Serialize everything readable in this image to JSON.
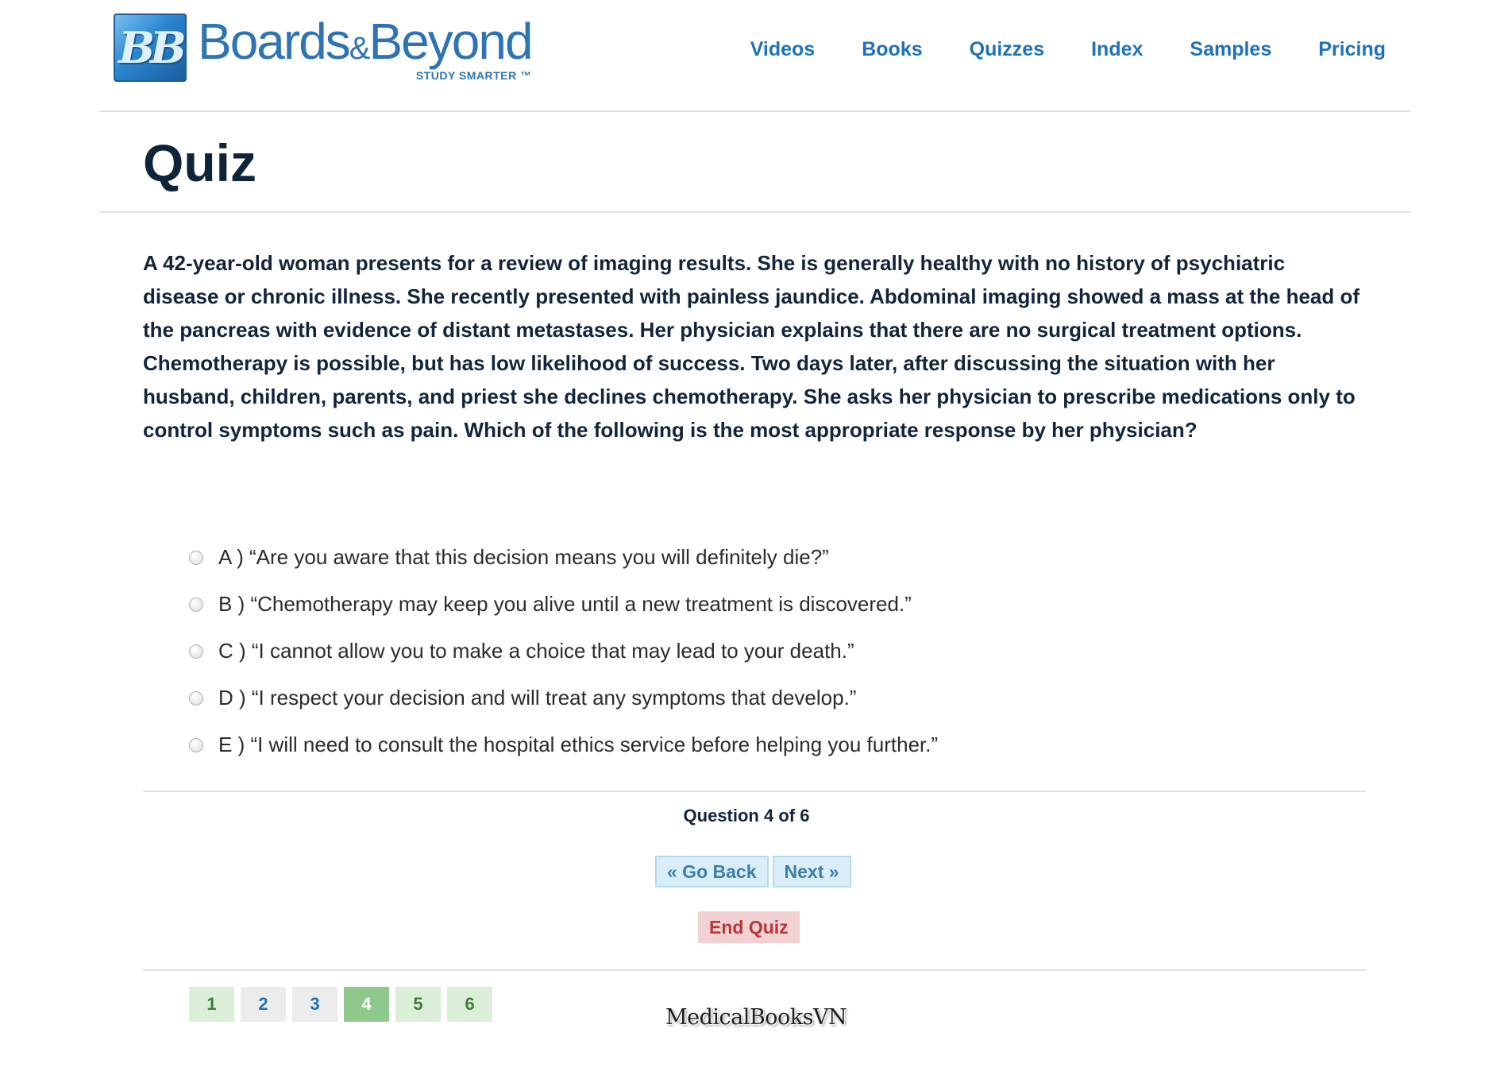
{
  "logo": {
    "mark": "BB",
    "wordmark_left": "Boards",
    "wordmark_amp": "&",
    "wordmark_right": "Beyond",
    "tagline": "STUDY SMARTER ™",
    "brand_color": "#2e74b5"
  },
  "nav": {
    "items": [
      "Videos",
      "Books",
      "Quizzes",
      "Index",
      "Samples",
      "Pricing"
    ]
  },
  "page": {
    "title": "Quiz"
  },
  "quiz": {
    "question": "A 42-year-old woman presents for a review of imaging results. She is generally healthy with no history of psychiatric disease or chronic illness. She recently presented with painless jaundice. Abdominal imaging showed a mass at the head of the pancreas with evidence of distant metastases. Her physician explains that there are no surgical treatment options. Chemotherapy is possible, but has low likelihood of success. Two days later, after discussing the situation with her husband, children, parents, and priest she declines chemotherapy. She asks her physician to prescribe medications only to control symptoms such as pain. Which of the following is the most appropriate response by her physician?",
    "options": [
      "A ) “Are you aware that this decision means you will definitely die?”",
      "B ) “Chemotherapy may keep you alive until a new treatment is discovered.”",
      "C ) “I cannot allow you to make a choice that may lead to your death.”",
      "D ) “I respect your decision and will treat any symptoms that develop.”",
      "E ) “I will need to consult the hospital ethics service before helping you further.”"
    ],
    "counter": "Question 4 of 6",
    "back_label": "« Go Back",
    "next_label": "Next »",
    "end_label": "End Quiz",
    "pages": [
      "1",
      "2",
      "3",
      "4",
      "5",
      "6"
    ],
    "current_page": "4"
  },
  "watermark": "MedicalBooksVN",
  "colors": {
    "nav_link": "#1f72b8",
    "end_quiz_bg": "#f2d1d2",
    "end_quiz_text": "#b6363b",
    "nav_button_bg": "#d9eef8",
    "page_current": "#8ec98b",
    "page_done": "#daeed8"
  }
}
